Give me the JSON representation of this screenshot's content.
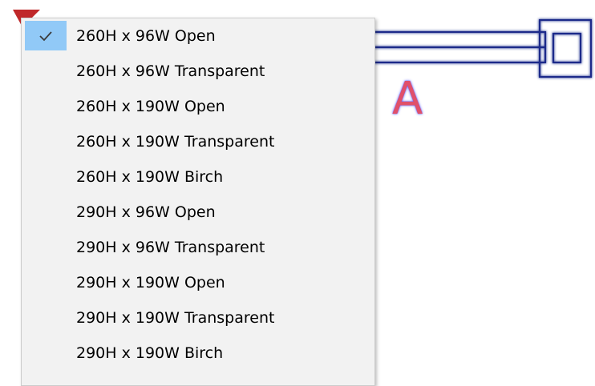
{
  "canvas": {
    "label": "A",
    "colors": {
      "line": "#1a2a8a",
      "glow": "#3c3cff",
      "label": "#e0506a",
      "marker": "#c0282a"
    }
  },
  "menu": {
    "items": [
      {
        "label": "260H x 96W Open",
        "checked": true
      },
      {
        "label": "260H x 96W Transparent",
        "checked": false
      },
      {
        "label": "260H x 190W Open",
        "checked": false
      },
      {
        "label": "260H x 190W Transparent",
        "checked": false
      },
      {
        "label": "260H x 190W Birch",
        "checked": false
      },
      {
        "label": "290H x 96W Open",
        "checked": false
      },
      {
        "label": "290H x 96W Transparent",
        "checked": false
      },
      {
        "label": "290H x 190W Open",
        "checked": false
      },
      {
        "label": "290H x 190W Transparent",
        "checked": false
      },
      {
        "label": "290H x 190W Birch",
        "checked": false
      }
    ],
    "check_icon": "checkmark-icon",
    "colors": {
      "background": "#f2f2f2",
      "selection": "#91c9f7",
      "text": "#000000"
    }
  }
}
